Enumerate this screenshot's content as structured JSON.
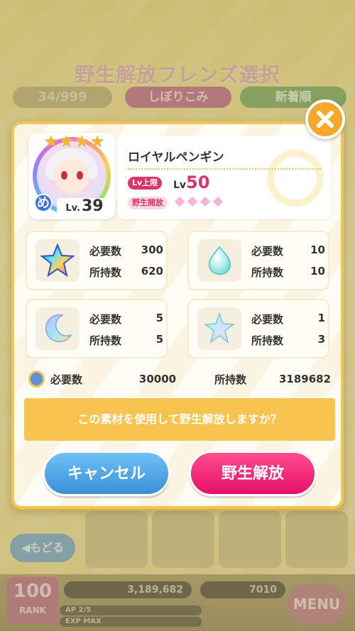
{
  "background": {
    "title": "野生解放フレンズ選択",
    "count": "34/999",
    "filter_label": "しぼりこみ",
    "sort_label": "新着順",
    "back_label": "◀もどる",
    "rank_value": "100",
    "rank_label": "RANK",
    "coins": "3,189,682",
    "items": "7010",
    "ap_label": "AP 2/5",
    "exp_label": "EXP MAX",
    "menu_label": "MENU"
  },
  "friend": {
    "name": "ロイヤルペンギン",
    "level_prefix": "Lv.",
    "level": "39",
    "lv_cap_tag": "Lv上限",
    "lv_cap_prefix": "Lv",
    "lv_cap_value": "50",
    "wild_release_tag": "野生開放",
    "stars": 4,
    "attribute_glyph": "め"
  },
  "materials": [
    {
      "icon": "rainbow-star-icon",
      "need_label": "必要数",
      "need": "300",
      "have_label": "所持数",
      "have": "620"
    },
    {
      "icon": "drop-icon",
      "need_label": "必要数",
      "need": "10",
      "have_label": "所持数",
      "have": "10"
    },
    {
      "icon": "moon-icon",
      "need_label": "必要数",
      "need": "5",
      "have_label": "所持数",
      "have": "5"
    },
    {
      "icon": "pastel-star-icon",
      "need_label": "必要数",
      "need": "1",
      "have_label": "所持数",
      "have": "3"
    }
  ],
  "gold": {
    "need_label": "必要数",
    "need": "30000",
    "have_label": "所持数",
    "have": "3189682"
  },
  "confirm_text": "この素材を使用して野生解放しますか？",
  "buttons": {
    "cancel": "キャンセル",
    "release": "野生解放"
  },
  "colors": {
    "accent": "#f2c552",
    "cancel": "#3b8fd9",
    "release": "#e6106b",
    "close": "#f7a72a"
  }
}
